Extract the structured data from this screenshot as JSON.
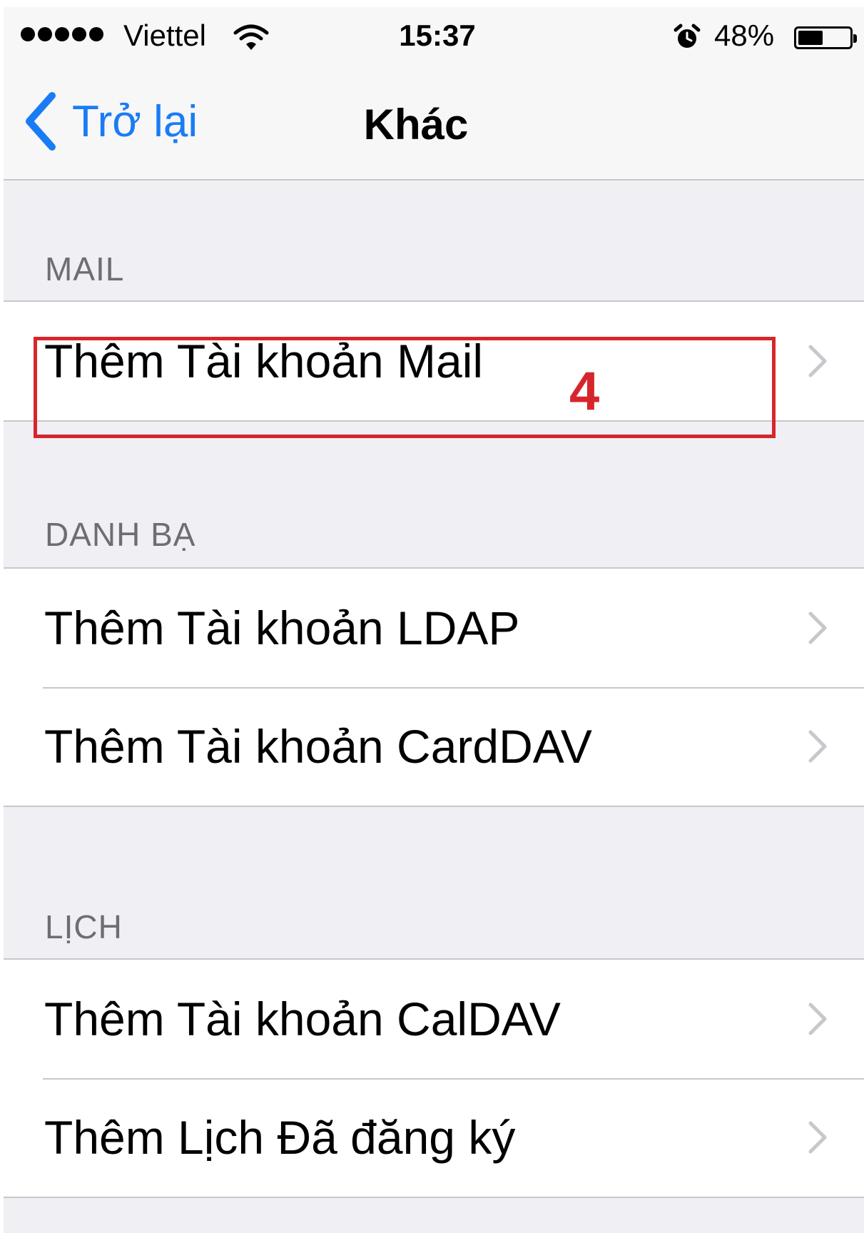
{
  "status_bar": {
    "carrier": "Viettel",
    "time": "15:37",
    "battery_percent": "48%",
    "battery_level": 0.48,
    "signal_bars": 5,
    "icons": [
      "signal-dots-icon",
      "wifi-icon",
      "alarm-icon",
      "battery-icon"
    ]
  },
  "nav": {
    "back_label": "Trở lại",
    "title": "Khác"
  },
  "sections": [
    {
      "header": "MAIL",
      "items": [
        {
          "label": "Thêm Tài khoản Mail"
        }
      ]
    },
    {
      "header": "DANH BẠ",
      "items": [
        {
          "label": "Thêm Tài khoản LDAP"
        },
        {
          "label": "Thêm Tài khoản CardDAV"
        }
      ]
    },
    {
      "header": "LỊCH",
      "items": [
        {
          "label": "Thêm Tài khoản CalDAV"
        },
        {
          "label": "Thêm Lịch Đã đăng ký"
        }
      ]
    }
  ],
  "annotation": {
    "number": "4",
    "color": "#d7262b"
  },
  "colors": {
    "accent": "#1a7cf5",
    "background": "#efeff4",
    "separator": "#c8c7cc",
    "section_header": "#6d6d72"
  }
}
